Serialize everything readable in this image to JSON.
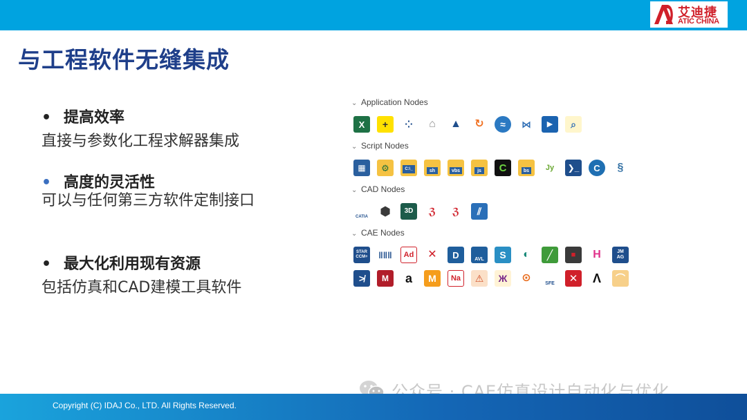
{
  "header": {
    "logo_cn": "艾迪捷",
    "logo_en": "ATIC CHINA",
    "logo_color": "#d0202a",
    "bar_color": "#00a3e0"
  },
  "title": "与工程软件无缝集成",
  "bullets": [
    {
      "marker": "•",
      "heading": "提高效率",
      "desc": "直接与参数化工程求解器集成"
    },
    {
      "marker": "•",
      "heading": "高度的灵活性",
      "desc": "可以与任何第三方软件定制接口"
    },
    {
      "marker": "•",
      "heading": "最大化利用现有资源",
      "desc": "包括仿真和CAD建模工具软件"
    }
  ],
  "nodes": {
    "sections": [
      {
        "label": "Application Nodes",
        "icons": [
          "excel-icon",
          "plus-arrow-icon",
          "dots-icon",
          "house-icon",
          "arrow-up-icon",
          "refresh-icon",
          "swirl-icon",
          "network-icon",
          "play-icon",
          "search-chart-icon"
        ]
      },
      {
        "label": "Script Nodes",
        "icons": [
          "calculator-icon",
          "gear-doc-icon",
          "cmd-icon",
          "sh-icon",
          "vbs-icon",
          "js-icon",
          "c-icon",
          "bs-icon",
          "jy-icon",
          "powershell-icon",
          "c-sharp-icon",
          "python-icon"
        ]
      },
      {
        "label": "CAD Nodes",
        "icons": [
          "catia-icon",
          "cube-icon",
          "3d-icon",
          "solidworks-icon",
          "solidworks-alt-icon",
          "sketch-icon"
        ]
      },
      {
        "label": "CAE Nodes",
        "icons": [
          "starccm-icon",
          "abaqus-icon",
          "adams-icon",
          "x-icon",
          "d-icon",
          "avl-icon",
          "s-icon",
          "swirl2-icon",
          "slash-icon",
          "square-icon",
          "h-icon",
          "jmag-icon",
          "kink-icon",
          "mx-icon",
          "a-icon",
          "m-icon",
          "na-icon",
          "tri-icon",
          "moth-icon",
          "gs-icon",
          "sfe-icon",
          "xred-icon",
          "lambda-icon",
          "wave-icon"
        ]
      }
    ],
    "icon_labels": {
      "cmd": "C:\\_",
      "sh": "sh",
      "vbs": "vbs",
      "js": "js",
      "bs": "bs",
      "jy": "Jy",
      "3d": "3D",
      "star": "STAR CCM+",
      "ad": "Ad",
      "avl": "AVL",
      "jmag": "JM AG",
      "na": "Na",
      "m": "M",
      "catia": "CATIA",
      "sfe": "SFE"
    }
  },
  "watermark": "公众号 · CAE仿真设计自动化与优化",
  "footer": {
    "copyright": "Copyright (C) IDAJ Co., LTD. All Rights Reserved."
  }
}
